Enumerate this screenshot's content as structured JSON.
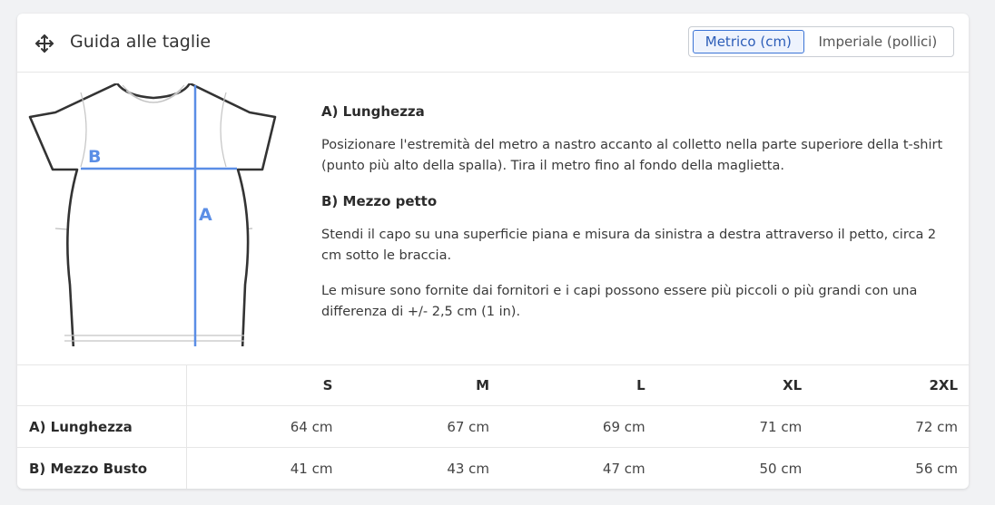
{
  "header": {
    "title": "Guida alle taglie",
    "icon": "move-icon",
    "unit_toggle": {
      "metric_label": "Metrico (cm)",
      "imperial_label": "Imperiale (pollici)",
      "selected": "metric"
    }
  },
  "diagram": {
    "label_a": "A",
    "label_b": "B",
    "accent_color": "#5b8ee6"
  },
  "instructions": {
    "a_title": "A) Lunghezza",
    "a_text": "Posizionare l'estremità del metro a nastro accanto al colletto nella parte superiore della t-shirt (punto più alto della spalla). Tira il metro fino al fondo della maglietta.",
    "b_title": "B) Mezzo petto",
    "b_text": "Stendi il capo su una superficie piana e misura da sinistra a destra attraverso il petto, circa 2 cm sotto le braccia.",
    "note": "Le misure sono fornite dai fornitori e i capi possono essere più piccoli o più grandi con una differenza di +/- 2,5 cm (1 in)."
  },
  "size_table": {
    "sizes": [
      "S",
      "M",
      "L",
      "XL",
      "2XL"
    ],
    "rows": [
      {
        "label": "A) Lunghezza",
        "values": [
          "64 cm",
          "67 cm",
          "69 cm",
          "71 cm",
          "72 cm"
        ]
      },
      {
        "label": "B) Mezzo Busto",
        "values": [
          "41 cm",
          "43 cm",
          "47 cm",
          "50 cm",
          "56 cm"
        ]
      }
    ]
  }
}
